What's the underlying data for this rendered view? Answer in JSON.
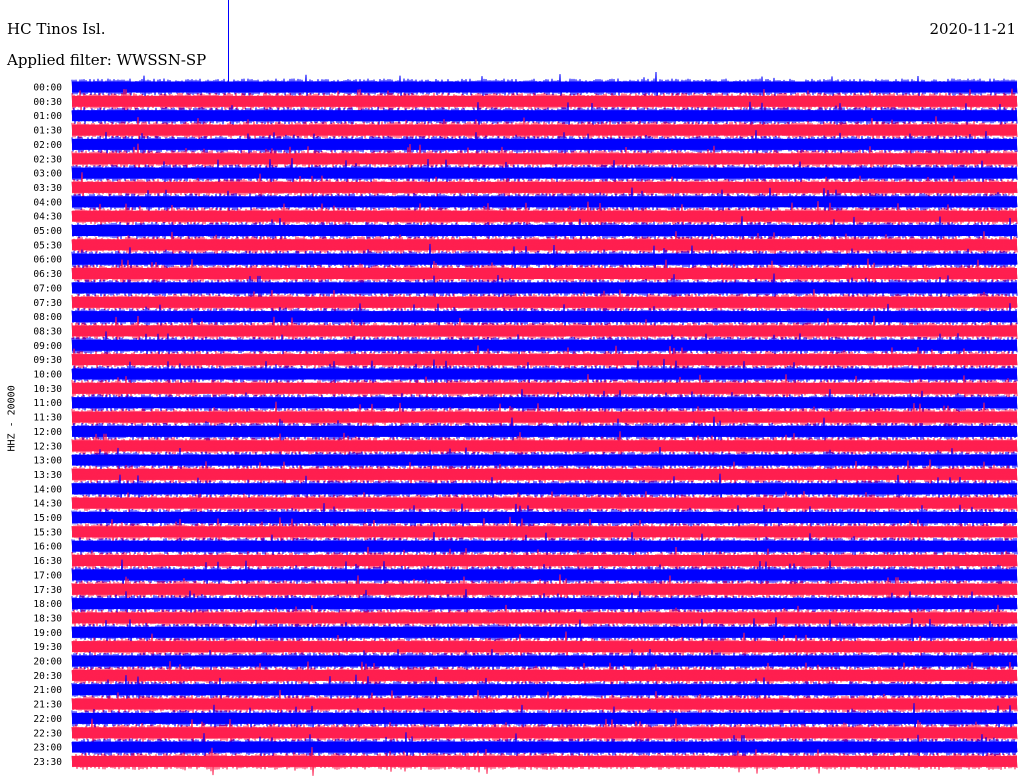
{
  "header": {
    "station": "HC Tinos Isl.",
    "filter": "Applied filter: WWSSN-SP",
    "date": "2020-11-21"
  },
  "chart_data": {
    "type": "line",
    "channel_label": "HHZ - 20000",
    "row_labels": [
      "00:00",
      "00:30",
      "01:00",
      "01:30",
      "02:00",
      "02:30",
      "03:00",
      "03:30",
      "04:00",
      "04:30",
      "05:00",
      "05:30",
      "06:00",
      "06:30",
      "07:00",
      "07:30",
      "08:00",
      "08:30",
      "09:00",
      "09:30",
      "10:00",
      "10:30",
      "11:00",
      "11:30",
      "12:00",
      "12:30",
      "13:00",
      "13:30",
      "14:00",
      "14:30",
      "15:00",
      "15:30",
      "16:00",
      "16:30",
      "17:00",
      "17:30",
      "18:00",
      "18:30",
      "19:00",
      "19:30",
      "20:00",
      "20:30",
      "21:00",
      "21:30",
      "22:00",
      "22:30",
      "23:00",
      "23:30"
    ],
    "series_colors": [
      "#0000ff",
      "#ff1f4f"
    ],
    "grid": false
  }
}
